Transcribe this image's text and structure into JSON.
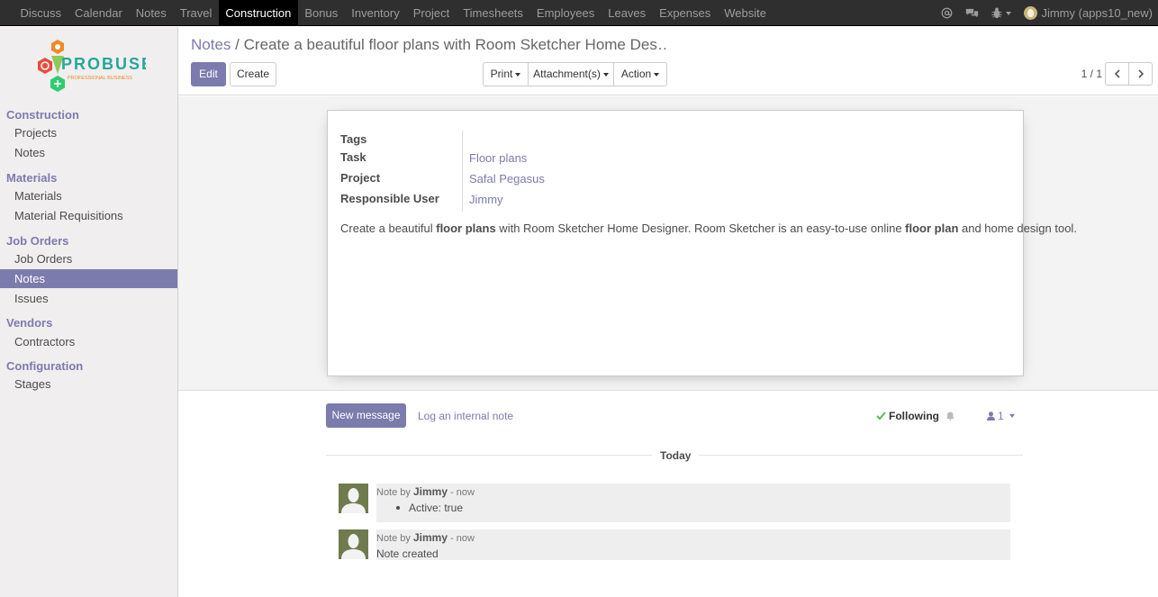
{
  "topbar": {
    "menu": [
      "Discuss",
      "Calendar",
      "Notes",
      "Travel",
      "Construction",
      "Bonus",
      "Inventory",
      "Project",
      "Timesheets",
      "Employees",
      "Leaves",
      "Expenses",
      "Website"
    ],
    "active_menu": "Construction",
    "user": "Jimmy (apps10_new)"
  },
  "logo": {
    "text": "PROBUSE",
    "tagline": "PROFESSIONAL BUSINESS"
  },
  "sidebar": {
    "sections": [
      {
        "title": "Construction",
        "items": [
          "Projects",
          "Notes"
        ]
      },
      {
        "title": "Materials",
        "items": [
          "Materials",
          "Material Requisitions"
        ]
      },
      {
        "title": "Job Orders",
        "items": [
          "Job Orders",
          "Notes",
          "Issues"
        ]
      },
      {
        "title": "Vendors",
        "items": [
          "Contractors"
        ]
      },
      {
        "title": "Configuration",
        "items": [
          "Stages"
        ]
      }
    ],
    "active_item": "Notes"
  },
  "breadcrumb": {
    "root": "Notes",
    "separator": "/",
    "current": "Create a beautiful  floor plans  with Room Sketcher Home Des…"
  },
  "buttons": {
    "edit": "Edit",
    "create": "Create",
    "print": "Print",
    "attachments": "Attachment(s)",
    "action": "Action"
  },
  "pager": {
    "value": "1 / 1"
  },
  "form": {
    "tags_label": "Tags",
    "task_label": "Task",
    "task_value": "Floor plans",
    "project_label": "Project",
    "project_value": "Safal Pegasus",
    "user_label": "Responsible User",
    "user_value": "Jimmy",
    "description": {
      "p1": "Create a beautiful ",
      "b1": "floor plans",
      "p2": " with Room Sketcher Home Designer. Room Sketcher is an easy-to-use online ",
      "b2": "floor plan",
      "p3": " and home design tool."
    }
  },
  "chatter": {
    "new_message": "New message",
    "log_note": "Log an internal note",
    "following": "Following",
    "followers_count": "1",
    "date_separator": "Today",
    "messages": [
      {
        "prefix": "Note by",
        "author": "Jimmy",
        "time": "- now",
        "text": "Active: true",
        "bulleted": true
      },
      {
        "prefix": "Note by",
        "author": "Jimmy",
        "time": "- now",
        "text": "Note created",
        "bulleted": false
      }
    ]
  },
  "colors": {
    "accent": "#7c7bad",
    "topbar": "#2f2f2f",
    "sidebar": "#f0eeee"
  }
}
